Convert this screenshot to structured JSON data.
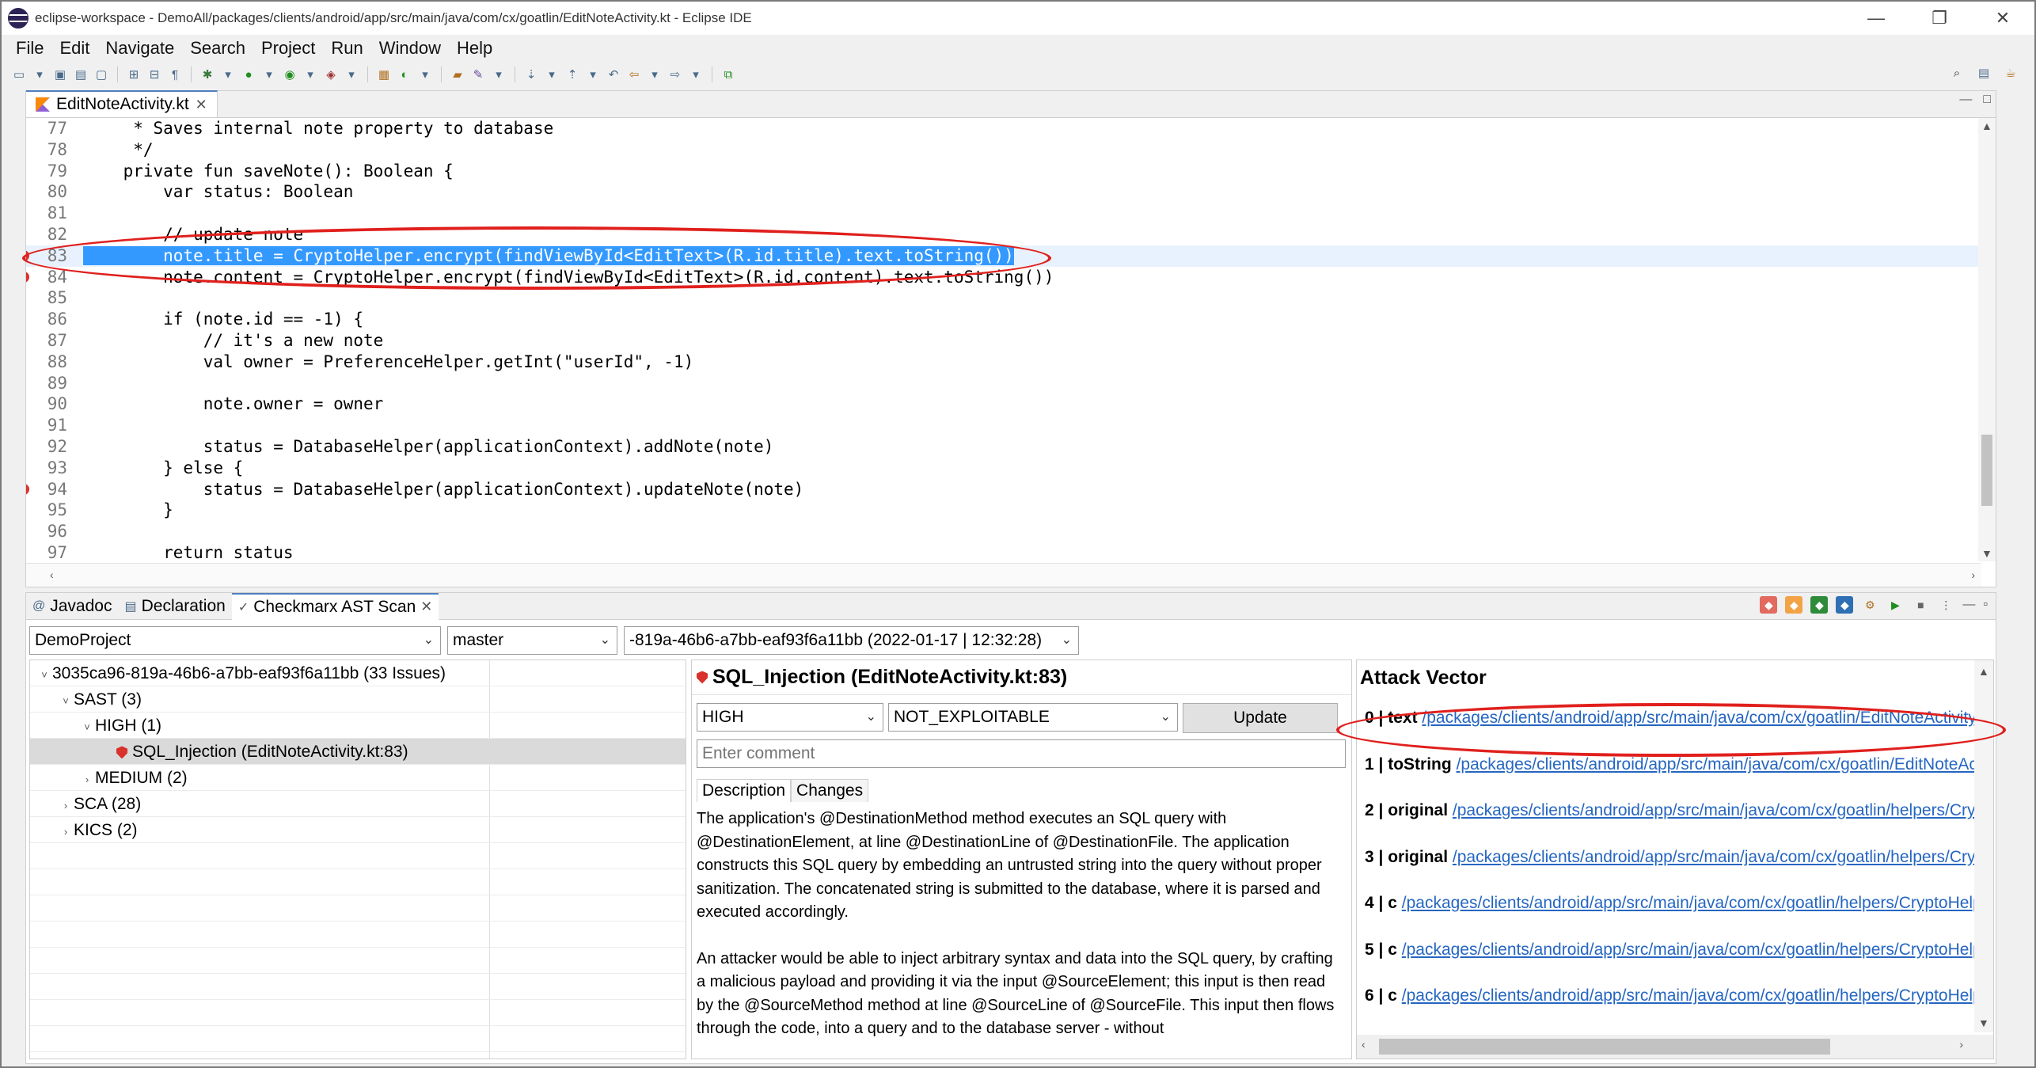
{
  "window": {
    "title": "eclipse-workspace - DemoAll/packages/clients/android/app/src/main/java/com/cx/goatlin/EditNoteActivity.kt - Eclipse IDE",
    "minimize": "—",
    "restore": "❐",
    "close": "✕"
  },
  "menu": [
    "File",
    "Edit",
    "Navigate",
    "Search",
    "Project",
    "Run",
    "Window",
    "Help"
  ],
  "editor": {
    "tab_label": "EditNoteActivity.kt",
    "lines": [
      {
        "num": "77",
        "text": "     * Saves internal note property to database"
      },
      {
        "num": "78",
        "text": "     */"
      },
      {
        "num": "79",
        "text": "    private fun saveNote(): Boolean {"
      },
      {
        "num": "80",
        "text": "        var status: Boolean"
      },
      {
        "num": "81",
        "text": ""
      },
      {
        "num": "82",
        "text": "        // update note"
      },
      {
        "num": "83",
        "text": "        note.title = CryptoHelper.encrypt(findViewById<EditText>(R.id.title).text.toString())"
      },
      {
        "num": "84",
        "text": "        note.content = CryptoHelper.encrypt(findViewById<EditText>(R.id.content).text.toString())"
      },
      {
        "num": "85",
        "text": ""
      },
      {
        "num": "86",
        "text": "        if (note.id == -1) {"
      },
      {
        "num": "87",
        "text": "            // it's a new note"
      },
      {
        "num": "88",
        "text": "            val owner = PreferenceHelper.getInt(\"userId\", -1)"
      },
      {
        "num": "89",
        "text": ""
      },
      {
        "num": "90",
        "text": "            note.owner = owner"
      },
      {
        "num": "91",
        "text": ""
      },
      {
        "num": "92",
        "text": "            status = DatabaseHelper(applicationContext).addNote(note)"
      },
      {
        "num": "93",
        "text": "        } else {"
      },
      {
        "num": "94",
        "text": "            status = DatabaseHelper(applicationContext).updateNote(note)"
      },
      {
        "num": "95",
        "text": "        }"
      },
      {
        "num": "96",
        "text": ""
      },
      {
        "num": "97",
        "text": "        return status"
      }
    ]
  },
  "views": {
    "tabs": [
      {
        "label": "Javadoc",
        "icon": "javadoc-icon"
      },
      {
        "label": "Declaration",
        "icon": "declaration-icon"
      },
      {
        "label": "Checkmarx AST Scan",
        "icon": "checkmarx-icon"
      }
    ],
    "project_combo": "DemoProject",
    "branch_combo": "master",
    "scan_combo": "-819a-46b6-a7bb-eaf93f6a11bb (2022-01-17 | 12:32:28)",
    "tree": [
      {
        "label": "3035ca96-819a-46b6-a7bb-eaf93f6a11bb (33 Issues)",
        "depth": 0,
        "caret": "˅"
      },
      {
        "label": "SAST (3)",
        "depth": 1,
        "caret": "˅"
      },
      {
        "label": "HIGH (1)",
        "depth": 2,
        "caret": "˅"
      },
      {
        "label": "SQL_Injection (EditNoteActivity.kt:83)",
        "depth": 3,
        "caret": "",
        "icon": true,
        "selected": true
      },
      {
        "label": "MEDIUM (2)",
        "depth": 2,
        "caret": "›"
      },
      {
        "label": "SCA (28)",
        "depth": 1,
        "caret": "›"
      },
      {
        "label": "KICS (2)",
        "depth": 1,
        "caret": "›"
      }
    ],
    "detail": {
      "title": "SQL_Injection (EditNoteActivity.kt:83)",
      "severity": "HIGH",
      "state": "NOT_EXPLOITABLE",
      "update_label": "Update",
      "comment_placeholder": "Enter comment",
      "tab_description": "Description",
      "tab_changes": "Changes",
      "paragraph1": "The application's @DestinationMethod method executes an SQL query with @DestinationElement, at line @DestinationLine of @DestinationFile. The application constructs this SQL query by embedding an untrusted string into the query without proper sanitization. The concatenated string is submitted to the database, where it is parsed and executed accordingly.",
      "paragraph2": "An attacker would be able to inject arbitrary syntax and data into the SQL query, by crafting a malicious payload and providing it via the input @SourceElement; this input is then read by the @SourceMethod method at line @SourceLine of @SourceFile. This input then flows through the code, into a query and to the database server - without"
    },
    "attack_vector": {
      "title": "Attack Vector",
      "rows": [
        {
          "prefix": "0 | text",
          "link": "/packages/clients/android/app/src/main/java/com/cx/goatlin/EditNoteActivity.kt"
        },
        {
          "prefix": "1 | toString",
          "link": "/packages/clients/android/app/src/main/java/com/cx/goatlin/EditNoteActivity.kt"
        },
        {
          "prefix": "2 | original",
          "link": "/packages/clients/android/app/src/main/java/com/cx/goatlin/helpers/CryptoHelper.kt"
        },
        {
          "prefix": "3 | original",
          "link": "/packages/clients/android/app/src/main/java/com/cx/goatlin/helpers/CryptoHelper.kt"
        },
        {
          "prefix": "4 | c",
          "link": "/packages/clients/android/app/src/main/java/com/cx/goatlin/helpers/CryptoHelper.kt"
        },
        {
          "prefix": "5 | c",
          "link": "/packages/clients/android/app/src/main/java/com/cx/goatlin/helpers/CryptoHelper.kt"
        },
        {
          "prefix": "6 | c",
          "link": "/packages/clients/android/app/src/main/java/com/cx/goatlin/helpers/CryptoHelper.kt"
        }
      ]
    }
  },
  "colors": {
    "selection": "#3399ff",
    "annotation": "#e0201d",
    "link": "#2566c2"
  }
}
